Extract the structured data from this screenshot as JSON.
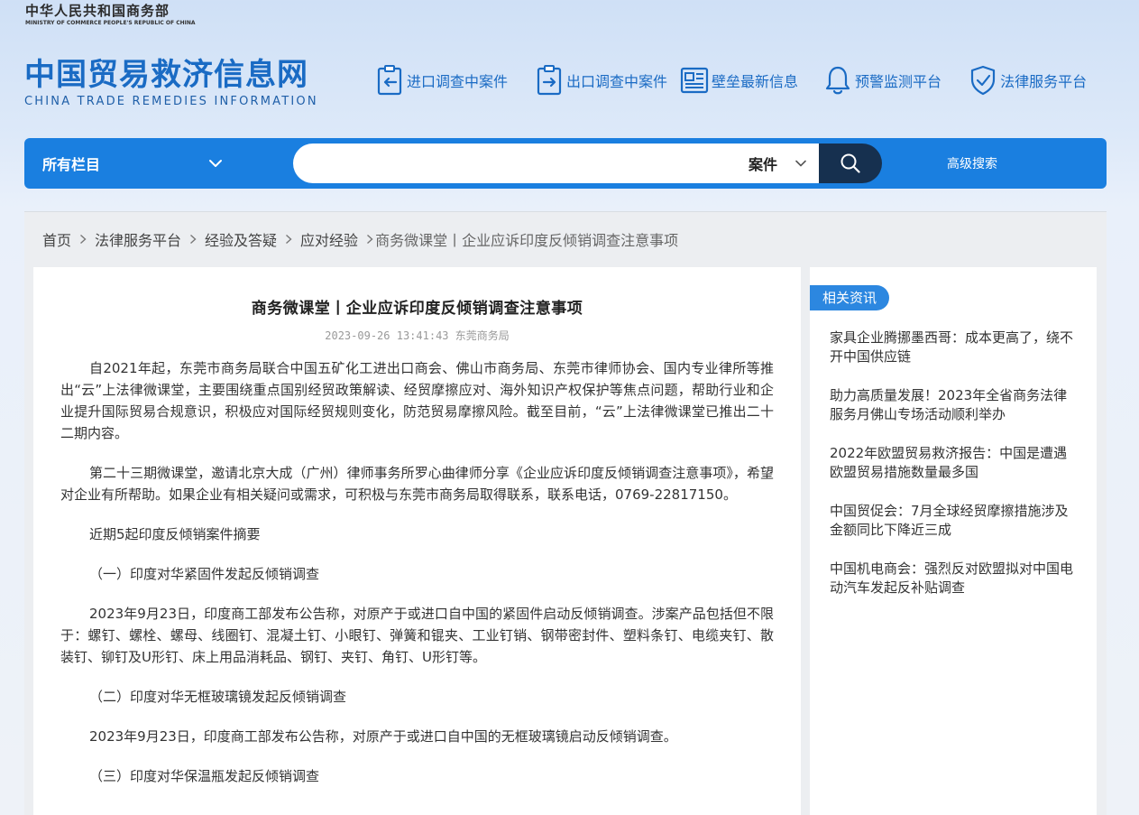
{
  "ministry": {
    "name_cn": "中华人民共和国商务部",
    "name_en": "MINISTRY OF COMMERCE PEOPLE'S REPUBLIC OF CHINA"
  },
  "site": {
    "title_cn": "中国贸易救济信息网",
    "title_en": "CHINA TRADE REMEDIES INFORMATION"
  },
  "topnav": {
    "items": [
      {
        "label": "进口调查中案件",
        "icon": "import-document-icon"
      },
      {
        "label": "出口调查中案件",
        "icon": "export-document-icon"
      },
      {
        "label": "壁垒最新信息",
        "icon": "news-icon"
      },
      {
        "label": "预警监测平台",
        "icon": "bell-icon"
      },
      {
        "label": "法律服务平台",
        "icon": "shield-check-icon"
      }
    ]
  },
  "search": {
    "category": "所有栏目",
    "query": "",
    "type": "案件",
    "advanced_label": "高级搜索"
  },
  "breadcrumb": {
    "items": [
      "首页",
      "法律服务平台",
      "经验及答疑",
      "应对经验"
    ],
    "current": "商务微课堂丨企业应诉印度反倾销调查注意事项"
  },
  "article": {
    "title": "商务微课堂丨企业应诉印度反倾销调查注意事项",
    "meta": "2023-09-26 13:41:43 东莞商务局",
    "paragraphs": [
      "自2021年起，东莞市商务局联合中国五矿化工进出口商会、佛山市商务局、东莞市律师协会、国内专业律所等推出“云”上法律微课堂，主要围绕重点国别经贸政策解读、经贸摩擦应对、海外知识产权保护等焦点问题，帮助行业和企业提升国际贸易合规意识，积极应对国际经贸规则变化，防范贸易摩擦风险。截至目前，“云”上法律微课堂已推出二十二期内容。",
      "第二十三期微课堂，邀请北京大成（广州）律师事务所罗心曲律师分享《企业应诉印度反倾销调查注意事项》，希望对企业有所帮助。如果企业有相关疑问或需求，可积极与东莞市商务局取得联系，联系电话，0769-22817150。",
      "近期5起印度反倾销案件摘要",
      "（一）印度对华紧固件发起反倾销调查",
      "2023年9月23日，印度商工部发布公告称，对原产于或进口自中国的紧固件启动反倾销调查。涉案产品包括但不限于：螺钉、螺栓、螺母、线圈钉、混凝土钉、小眼钉、弹簧和锟夹、工业钉销、钢带密封件、塑料条钉、电缆夹钉、散装钉、铆钉及U形钉、床上用品消耗品、钢钉、夹钉、角钉、U形钉等。",
      "（二）印度对华无框玻璃镜发起反倾销调查",
      "2023年9月23日，印度商工部发布公告称，对原产于或进口自中国的无框玻璃镜启动反倾销调查。",
      "（三）印度对华保温瓶发起反倾销调查"
    ]
  },
  "related": {
    "heading": "相关资讯",
    "items": [
      "家具企业腾挪墨西哥：成本更高了，绕不开中国供应链",
      "助力高质量发展！2023年全省商务法律服务月佛山专场活动顺利举办",
      "2022年欧盟贸易救济报告：中国是遭遇欧盟贸易措施数量最多国",
      "中国贸促会：7月全球经贸摩擦措施涉及金额同比下降近三成",
      "中国机电商会：强烈反对欧盟拟对中国电动汽车发起反补贴调查"
    ]
  },
  "colors": {
    "brand": "#1a6bc4",
    "search_bar": "#1a7fe0",
    "search_button": "#16304f"
  }
}
